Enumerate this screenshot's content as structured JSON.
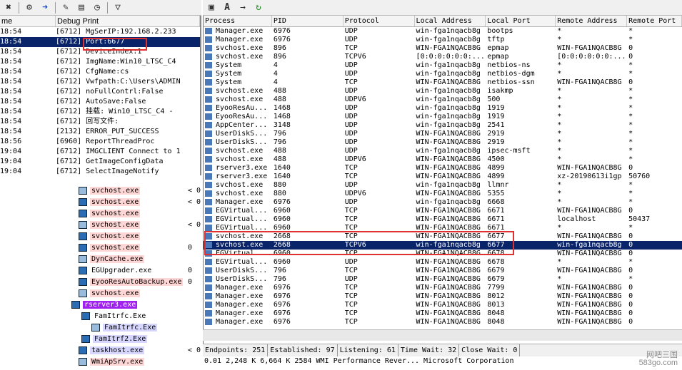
{
  "debug": {
    "col_time": "me",
    "col_print": "Debug Print",
    "rows": [
      {
        "t": "18:54",
        "m": "[6712] MgSerIP:192.168.2.233"
      },
      {
        "t": "18:54",
        "m": "[6712] Port:6677"
      },
      {
        "t": "18:54",
        "m": "[6712] DeviceIndex:1"
      },
      {
        "t": "18:54",
        "m": "[6712] ImgName:Win10_LTSC_C4"
      },
      {
        "t": "18:54",
        "m": "[6712] CfgName:cs"
      },
      {
        "t": "18:54",
        "m": "[6712] Vwfpath:C:\\Users\\ADMIN"
      },
      {
        "t": "18:54",
        "m": "[6712] noFullContrl:False"
      },
      {
        "t": "18:54",
        "m": "[6712] AutoSave:False"
      },
      {
        "t": "18:54",
        "m": "[6712] 挂载: Win10_LTSC_C4 - "
      },
      {
        "t": "18:54",
        "m": "[6712] 回写文件:"
      },
      {
        "t": "18:54",
        "m": "[2132] ERROR_PUT_SUCCESS"
      },
      {
        "t": "18:56",
        "m": "[6960] ReportThreadProc"
      },
      {
        "t": "19:04",
        "m": "[6712] IMGCLIENT Connect to 1"
      },
      {
        "t": "19:04",
        "m": "[6712] GetImageConfigData"
      },
      {
        "t": "19:04",
        "m": "[6712] SelectImageNotify"
      }
    ]
  },
  "tree": [
    {
      "name": "svchost.exe",
      "cpu": "< 0",
      "bg": "#ffd6d6"
    },
    {
      "name": "svchost.exe",
      "cpu": "< 0",
      "bg": "#ffd6d6"
    },
    {
      "name": "svchost.exe",
      "cpu": "",
      "bg": "#ffd6d6"
    },
    {
      "name": "svchost.exe",
      "cpu": "< 0",
      "bg": "#ffd6d6"
    },
    {
      "name": "svchost.exe",
      "cpu": "",
      "bg": "#ffd6d6"
    },
    {
      "name": "svchost.exe",
      "cpu": "0",
      "bg": "#ffd6d6"
    },
    {
      "name": "DynCache.exe",
      "cpu": "",
      "bg": "#ffd6d6"
    },
    {
      "name": "EGUpgrader.exe",
      "cpu": "0",
      "bg": "#ffffff"
    },
    {
      "name": "EyooResAutoBackup.exe",
      "cpu": "0",
      "bg": "#ffd6d6"
    },
    {
      "name": "svchost.exe",
      "cpu": "",
      "bg": "#ffd6d6"
    },
    {
      "name": "rserver3.exe",
      "cpu": "",
      "bg": "#a020f0"
    },
    {
      "name": "FamItrfc.Exe",
      "cpu": "",
      "bg": "#ffffff"
    },
    {
      "name": "FamItrfc.Exe",
      "cpu": "",
      "bg": "#d6d6ff"
    },
    {
      "name": "FamItrf2.Exe",
      "cpu": "",
      "bg": "#d6d6ff"
    },
    {
      "name": "taskhost.exe",
      "cpu": "< 0",
      "bg": "#d6d6ff"
    },
    {
      "name": "WmiApSrv.exe",
      "cpu": "",
      "bg": "#ffd6d6"
    }
  ],
  "tcp": {
    "headers": [
      "Process",
      "PID",
      "Protocol",
      "Local Address",
      "Local Port",
      "Remote Address",
      "Remote Port"
    ],
    "rows": [
      [
        "Manager.exe",
        "6976",
        "UDP",
        "win-fga1nqacb8g",
        "bootps",
        "*",
        "*"
      ],
      [
        "Manager.exe",
        "6976",
        "UDP",
        "win-fga1nqacb8g",
        "tftp",
        "*",
        "*"
      ],
      [
        "svchost.exe",
        "896",
        "TCP",
        "WIN-FGA1NQACB8G",
        "epmap",
        "WIN-FGA1NQACB8G",
        "0"
      ],
      [
        "svchost.exe",
        "896",
        "TCPV6",
        "[0:0:0:0:0:0:...",
        "epmap",
        "[0:0:0:0:0:0:...",
        "0"
      ],
      [
        "System",
        "4",
        "UDP",
        "win-fga1nqacb8g",
        "netbios-ns",
        "*",
        "*"
      ],
      [
        "System",
        "4",
        "UDP",
        "win-fga1nqacb8g",
        "netbios-dgm",
        "*",
        "*"
      ],
      [
        "System",
        "4",
        "TCP",
        "WIN-FGA1NQACB8G",
        "netbios-ssn",
        "WIN-FGA1NQACB8G",
        "0"
      ],
      [
        "svchost.exe",
        "488",
        "UDP",
        "win-fga1nqacb8g",
        "isakmp",
        "*",
        "*"
      ],
      [
        "svchost.exe",
        "488",
        "UDPV6",
        "win-fga1nqacb8g",
        "500",
        "*",
        "*"
      ],
      [
        "EyooResAu...",
        "1468",
        "UDP",
        "win-fga1nqacb8g",
        "1919",
        "*",
        "*"
      ],
      [
        "EyooResAu...",
        "1468",
        "UDP",
        "win-fga1nqacb8g",
        "1919",
        "*",
        "*"
      ],
      [
        "AppCenter...",
        "3148",
        "UDP",
        "win-fga1nqacb8g",
        "2541",
        "*",
        "*"
      ],
      [
        "UserDiskS...",
        "796",
        "UDP",
        "WIN-FGA1NQACB8G",
        "2919",
        "*",
        "*"
      ],
      [
        "UserDiskS...",
        "796",
        "UDP",
        "WIN-FGA1NQACB8G",
        "2919",
        "*",
        "*"
      ],
      [
        "svchost.exe",
        "488",
        "UDP",
        "win-fga1nqacb8g",
        "ipsec-msft",
        "*",
        "*"
      ],
      [
        "svchost.exe",
        "488",
        "UDPV6",
        "WIN-FGA1NQACB8G",
        "4500",
        "*",
        "*"
      ],
      [
        "rserver3.exe",
        "1640",
        "TCP",
        "WIN-FGA1NQACB8G",
        "4899",
        "WIN-FGA1NQACB8G",
        "0"
      ],
      [
        "rserver3.exe",
        "1640",
        "TCP",
        "WIN-FGA1NQACB8G",
        "4899",
        "xz-20190613i1gp",
        "50760"
      ],
      [
        "svchost.exe",
        "880",
        "UDP",
        "win-fga1nqacb8g",
        "llmnr",
        "*",
        "*"
      ],
      [
        "svchost.exe",
        "880",
        "UDPV6",
        "WIN-FGA1NQACB8G",
        "5355",
        "*",
        "*"
      ],
      [
        "Manager.exe",
        "6976",
        "UDP",
        "win-fga1nqacb8g",
        "6668",
        "*",
        "*"
      ],
      [
        "EGVirtual...",
        "6960",
        "TCP",
        "WIN-FGA1NQACB8G",
        "6671",
        "WIN-FGA1NQACB8G",
        "0"
      ],
      [
        "EGVirtual...",
        "6960",
        "TCP",
        "WIN-FGA1NQACB8G",
        "6671",
        "localhost",
        "50437"
      ],
      [
        "EGVirtual...",
        "6960",
        "TCP",
        "WIN-FGA1NQACB8G",
        "6671",
        "*",
        "*"
      ],
      [
        "svchost.exe",
        "2668",
        "TCP",
        "WIN-FGA1NQACB8G",
        "6677",
        "WIN-FGA1NQACB8G",
        "0"
      ],
      [
        "svchost.exe",
        "2668",
        "TCPV6",
        "win-fga1nqacb8g",
        "6677",
        "win-fga1nqacb8g",
        "0"
      ],
      [
        "EGVirtual...",
        "6960",
        "TCP",
        "WIN-FGA1NQACB8G",
        "6678",
        "WIN-FGA1NQACB8G",
        "0"
      ],
      [
        "EGVirtual...",
        "6960",
        "UDP",
        "WIN-FGA1NQACB8G",
        "6678",
        "*",
        "*"
      ],
      [
        "UserDiskS...",
        "796",
        "TCP",
        "WIN-FGA1NQACB8G",
        "6679",
        "WIN-FGA1NQACB8G",
        "0"
      ],
      [
        "UserDiskS...",
        "796",
        "UDP",
        "WIN-FGA1NQACB8G",
        "6679",
        "*",
        "*"
      ],
      [
        "Manager.exe",
        "6976",
        "TCP",
        "WIN-FGA1NQACB8G",
        "7799",
        "WIN-FGA1NQACB8G",
        "0"
      ],
      [
        "Manager.exe",
        "6976",
        "TCP",
        "WIN-FGA1NQACB8G",
        "8012",
        "WIN-FGA1NQACB8G",
        "0"
      ],
      [
        "Manager.exe",
        "6976",
        "TCP",
        "WIN-FGA1NQACB8G",
        "8013",
        "WIN-FGA1NQACB8G",
        "0"
      ],
      [
        "Manager.exe",
        "6976",
        "TCP",
        "WIN-FGA1NQACB8G",
        "8048",
        "WIN-FGA1NQACB8G",
        "0"
      ],
      [
        "Manager.exe",
        "6976",
        "TCP",
        "WIN-FGA1NQACB8G",
        "8048",
        "WIN-FGA1NQACB8G",
        "0"
      ]
    ]
  },
  "status": {
    "endpoints": "Endpoints: 251",
    "established": "Established: 97",
    "listening": "Listening: 61",
    "timewait": "Time Wait: 32",
    "closewait": "Close Wait: 0"
  },
  "bottom_text": "0.01     2,248 K     6,664 K   2584 WMI Performance Rever...  Microsoft Corporation",
  "watermark": {
    "line1": "网吧三国",
    "line2": "583go.com"
  },
  "colors": {
    "selection": "#0a246a",
    "highlight_box": "#e03030"
  }
}
